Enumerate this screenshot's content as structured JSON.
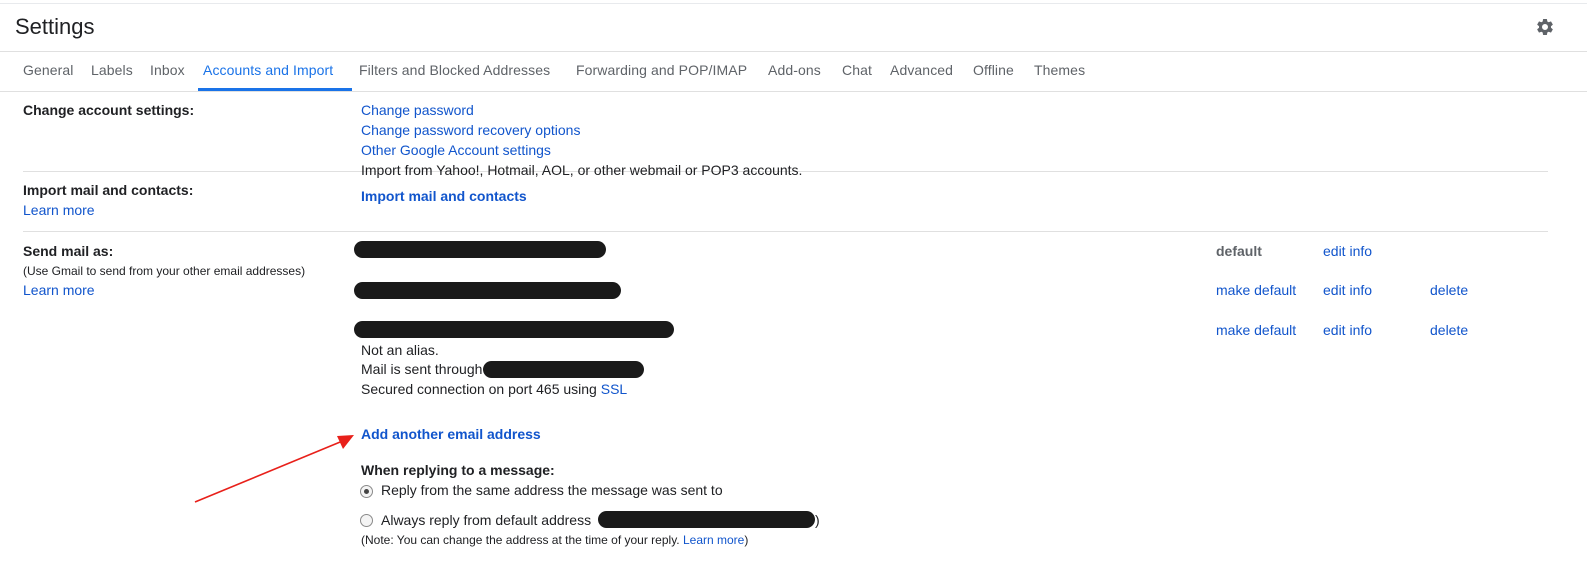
{
  "header": {
    "title": "Settings",
    "settings_icon": "gear-icon"
  },
  "tabs": [
    {
      "label": "General",
      "active": false
    },
    {
      "label": "Labels",
      "active": false
    },
    {
      "label": "Inbox",
      "active": false
    },
    {
      "label": "Accounts and Import",
      "active": true
    },
    {
      "label": "Filters and Blocked Addresses",
      "active": false
    },
    {
      "label": "Forwarding and POP/IMAP",
      "active": false
    },
    {
      "label": "Add-ons",
      "active": false
    },
    {
      "label": "Chat",
      "active": false
    },
    {
      "label": "Advanced",
      "active": false
    },
    {
      "label": "Offline",
      "active": false
    },
    {
      "label": "Themes",
      "active": false
    }
  ],
  "change_account": {
    "label": "Change account settings:",
    "links": [
      "Change password",
      "Change password recovery options",
      "Other Google Account settings"
    ]
  },
  "import": {
    "label": "Import mail and contacts:",
    "learn_more": "Learn more",
    "description": "Import from Yahoo!, Hotmail, AOL, or other webmail or POP3 accounts.",
    "action": "Import mail and contacts"
  },
  "send_as": {
    "label": "Send mail as:",
    "sublabel": "(Use Gmail to send from your other email addresses)",
    "learn_more": "Learn more",
    "rows": [
      {
        "status": "default",
        "edit": "edit info"
      },
      {
        "status": "make default",
        "edit": "edit info",
        "delete": "delete"
      },
      {
        "status": "make default",
        "edit": "edit info",
        "delete": "delete"
      }
    ],
    "not_alias": "Not an alias.",
    "sent_through": "Mail is sent through",
    "secured_prefix": "Secured connection on port 465 using ",
    "secured_link": "SSL",
    "add_address": "Add another email address",
    "reply_heading": "When replying to a message:",
    "reply_options": [
      {
        "label": "Reply from the same address the message was sent to",
        "checked": true
      },
      {
        "label": "Always reply from default address",
        "checked": false
      }
    ],
    "reply_suffix": ")",
    "note_prefix": "(Note: You can change the address at the time of your reply. ",
    "note_link": "Learn more",
    "note_suffix": ")"
  },
  "annotation": {
    "arrow_color": "#e8201a"
  },
  "colors": {
    "accent": "#1a73e8",
    "link": "#1155cc"
  }
}
